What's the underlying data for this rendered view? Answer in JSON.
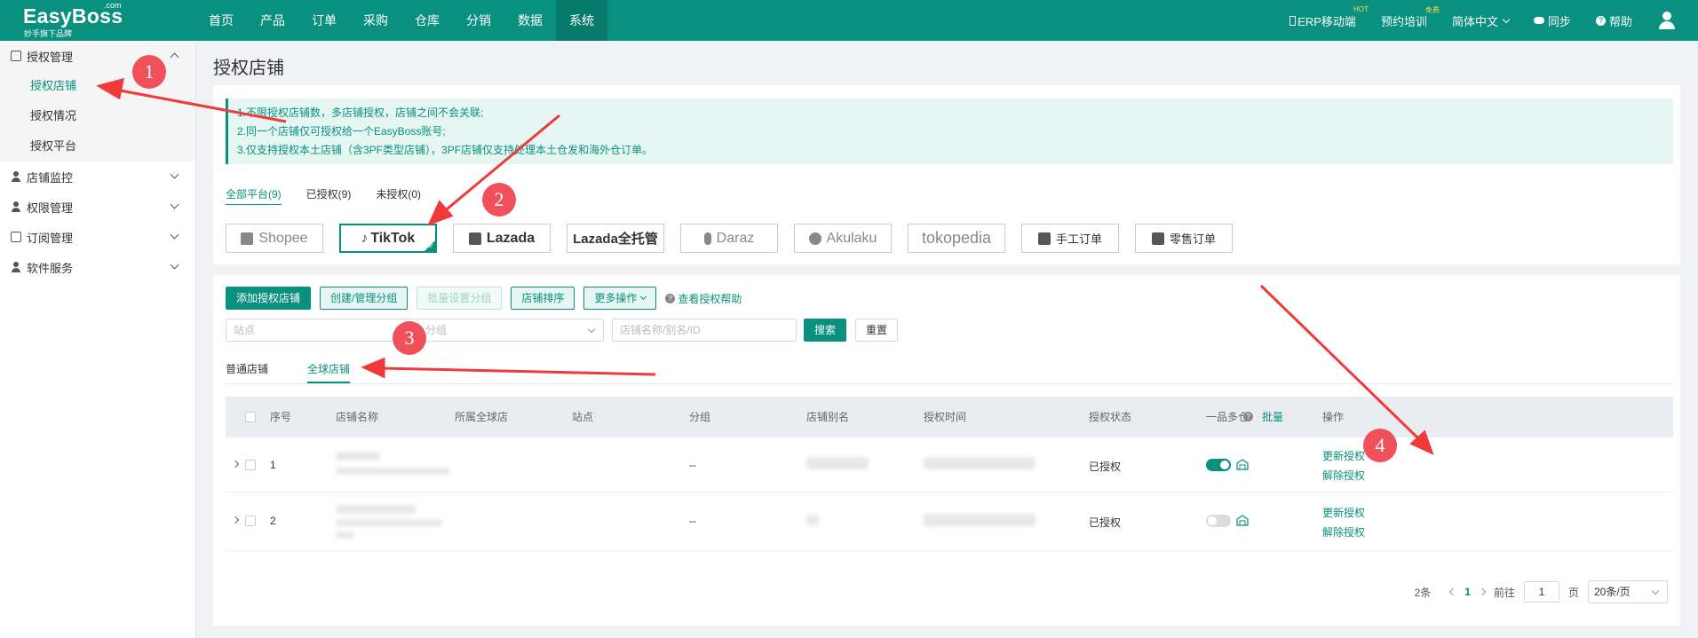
{
  "brand": {
    "name": "EasyBoss",
    "com": ".com",
    "slogan": "妙手旗下品牌"
  },
  "nav": [
    "首页",
    "产品",
    "订单",
    "采购",
    "仓库",
    "分销",
    "数据",
    "系统"
  ],
  "top_right": {
    "mobile": "ERP移动端",
    "mobile_badge": "HOT",
    "training": "预约培训",
    "training_badge": "免费",
    "language": "简体中文",
    "sync": "同步",
    "help": "帮助"
  },
  "sidebar": {
    "groups": [
      {
        "label": "授权管理",
        "items": [
          "授权店铺",
          "授权情况",
          "授权平台"
        ]
      },
      {
        "label": "店铺监控"
      },
      {
        "label": "权限管理"
      },
      {
        "label": "订阅管理"
      },
      {
        "label": "软件服务"
      }
    ]
  },
  "page": {
    "title": "授权店铺"
  },
  "notice": [
    "1.不限授权店铺数，多店铺授权，店铺之间不会关联;",
    "2.同一个店铺仅可授权给一个EasyBoss账号;",
    "3.仅支持授权本土店铺（含3PF类型店铺），3PF店铺仅支持处理本土仓发和海外仓订单。"
  ],
  "platform_tabs": [
    "全部平台(9)",
    "已授权(9)",
    "未授权(0)"
  ],
  "platforms": [
    "Shopee",
    "TikTok",
    "Lazada",
    "Lazada全托管",
    "Daraz",
    "Akulaku",
    "tokopedia",
    "手工订单",
    "零售订单"
  ],
  "toolbar": {
    "add": "添加授权店铺",
    "group": "创建/管理分组",
    "batch_group": "批量设置分组",
    "sort": "店铺排序",
    "more": "更多操作",
    "help": "查看授权帮助"
  },
  "filters": {
    "site_placeholder": "站点",
    "group_placeholder": "分组",
    "store_placeholder": "店铺名称/别名/ID",
    "search": "搜索",
    "reset": "重置"
  },
  "store_tabs": [
    "普通店铺",
    "全球店铺"
  ],
  "table": {
    "headers": [
      "序号",
      "店铺名称",
      "所属全球店",
      "站点",
      "分组",
      "店铺别名",
      "授权时间",
      "授权状态",
      "一品多仓",
      "批量",
      "操作"
    ],
    "rows": [
      {
        "index": "1",
        "group": "--",
        "status": "已授权",
        "toggle": true,
        "actions": [
          "更新授权",
          "解除授权"
        ]
      },
      {
        "index": "2",
        "group": "--",
        "status": "已授权",
        "toggle": false,
        "actions": [
          "更新授权",
          "解除授权"
        ]
      }
    ]
  },
  "pager": {
    "total": "2条",
    "current": "1",
    "goto": "前往",
    "page_input": "1",
    "page_unit": "页",
    "size": "20条/页"
  },
  "annotations": [
    "1",
    "2",
    "3",
    "4"
  ],
  "colors": {
    "brand": "#09907e",
    "annotation": "#f0505a"
  }
}
